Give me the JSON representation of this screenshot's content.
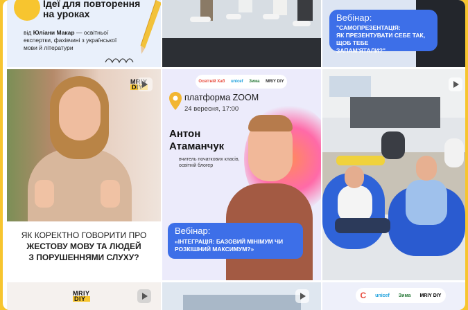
{
  "tiles": {
    "top_left": {
      "title_line1": "Ідеї для повторення",
      "title_line2": "на уроках",
      "author_prefix": "від",
      "author_name": "Юліани Макар",
      "author_desc_line1": "— освітньої",
      "author_desc_line2": "експертки, фахівчині з української",
      "author_desc_line3": "мови й літератури"
    },
    "top_right": {
      "label": "Вебінар:",
      "title_line1": "\"САМОПРЕЗЕНТАЦІЯ:",
      "title_line2": "ЯК ПРЕЗЕНТУВАТИ СЕБЕ ТАК, ЩОБ ТЕБЕ",
      "title_line3": "ЗАПАМ'ЯТАЛИ?\""
    },
    "middle_left": {
      "logo_line1": "MRIY",
      "logo_line2": "DIY",
      "caption_line1": "ЯК КОРЕКТНО ГОВОРИТИ ПРО",
      "caption_line2": "ЖЕСТОВУ МОВУ ТА ЛЮДЕЙ",
      "caption_line3": "З ПОРУШЕННЯМИ СЛУХУ?"
    },
    "middle_center": {
      "platform": "платформа ZOOM",
      "date": "24 вересня, 17:00",
      "speaker_first": "Антон",
      "speaker_last": "Атаманчук",
      "speaker_role_line1": "вчитель початкових класів,",
      "speaker_role_line2": "освітній блогер",
      "webinar_label": "Вебінар:",
      "webinar_title_line1": "«ІНТЕГРАЦІЯ: БАЗОВИЙ МІНІМУМ ЧИ",
      "webinar_title_line2": "РОЗКІШНИЙ МАКСИМУМ?»",
      "partner_logos": [
        "Освітній Хаб",
        "unicef",
        "Зима",
        "MRIY DIY"
      ]
    },
    "bottom_left": {
      "logo_line1": "MRIY",
      "logo_line2": "DIY"
    },
    "bottom_right": {
      "partner_logos": [
        "C",
        "unicef",
        "Зима",
        "MRIY DIY"
      ]
    }
  },
  "colors": {
    "accent_blue": "#3d6fe8",
    "border_yellow": "#f7c52f"
  }
}
